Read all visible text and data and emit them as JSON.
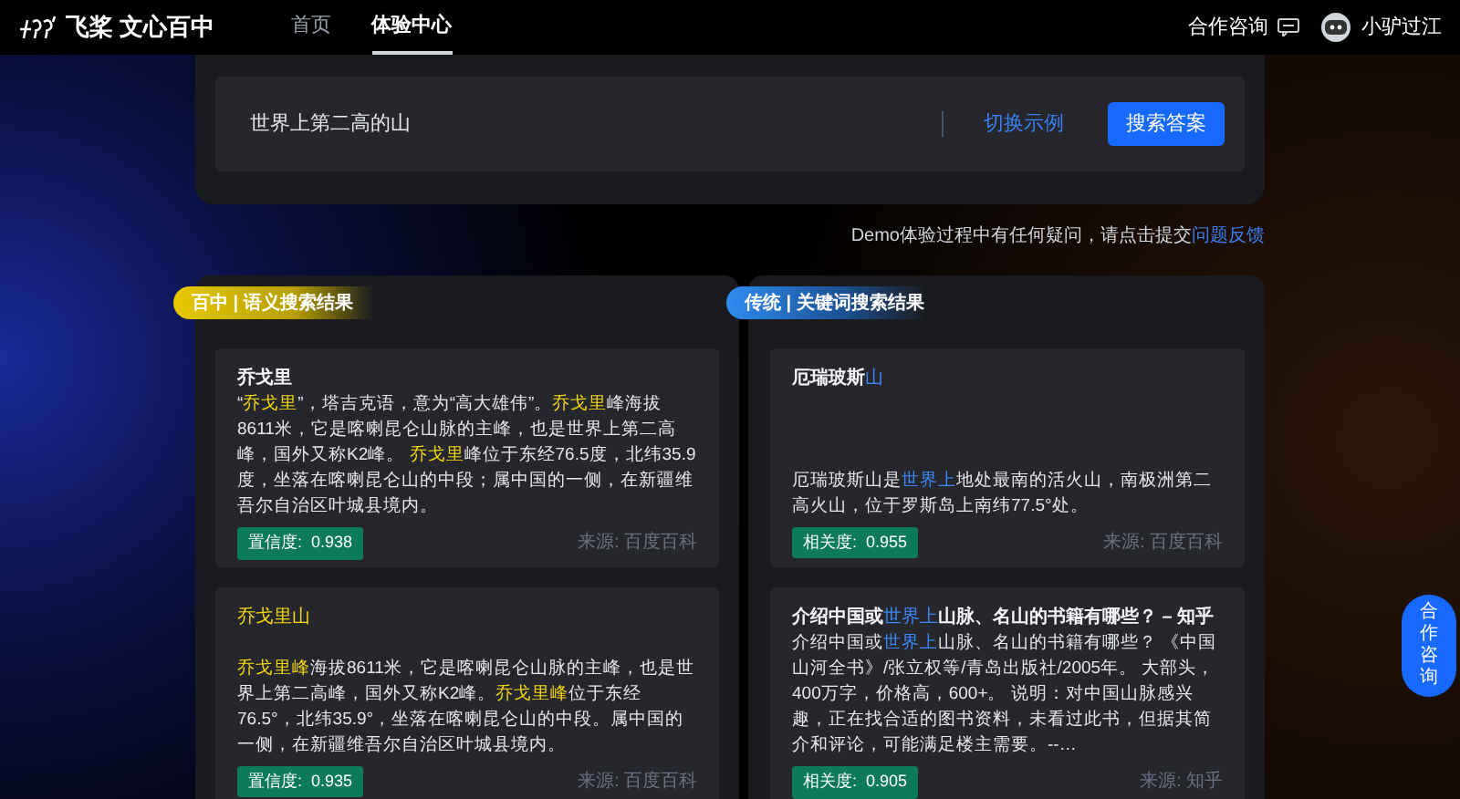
{
  "nav": {
    "logo": "飞桨 文心百中",
    "links": [
      {
        "label": "首页",
        "selected": false
      },
      {
        "label": "体验中心",
        "selected": true
      }
    ],
    "consult": "合作咨询",
    "user": "小驴过江"
  },
  "search": {
    "value": "世界上第二高的山",
    "switch_link": "切换示例",
    "button": "搜索答案"
  },
  "feedback": {
    "text": "Demo体验过程中有任何疑问，请点击提交",
    "link": "问题反馈"
  },
  "columns": [
    {
      "kind": "semantic",
      "badge": "百中 | 语义搜索结果",
      "results": [
        {
          "title": "乔戈里",
          "body": "“**乔戈里**”，塔吉克语，意为“高大雄伟”。**乔戈里**峰海拔8611米，它是喀喇昆仑山脉的主峰，也是世界上第二高峰，国外又称K2峰。 **乔戈里**峰位于东经76.5度，北纬35.9度，坐落在喀喇昆仑山的中段；属中国的一侧，在新疆维吾尔自治区叶城县境内。",
          "score": "置信度:  0.938",
          "source": "来源: 百度百科"
        },
        {
          "title": "**乔戈里山**",
          "body": "**乔戈里峰**海拔8611米，它是喀喇昆仑山脉的主峰，也是世界上第二高峰，国外又称K2峰。**乔戈里峰**位于东经76.5°，北纬35.9°，坐落在喀喇昆仑山的中段。属中国的一侧，在新疆维吾尔自治区叶城县境内。",
          "score": "置信度:  0.935",
          "source": "来源: 百度百科"
        }
      ]
    },
    {
      "kind": "keyword",
      "badge": "传统 | 关键词搜索结果",
      "results": [
        {
          "title": "厄瑞玻斯**山**",
          "body": "厄瑞玻斯山是**世界上**地处最南的活火山，南极洲第二高火山，位于罗斯岛上南纬77.5°处。",
          "score": "相关度:  0.955",
          "source": "来源: 百度百科"
        },
        {
          "title": "介绍中国或**世界上**山脉、名山的书籍有哪些？ – 知乎",
          "body": "介绍中国或**世界上**山脉、名山的书籍有哪些？ 《中国山河全书》/张立权等/青岛出版社/2005年。 大部头，400万字，价格高，600+。 说明：对中国山脉感兴趣，正在找合适的图书资料，未看过此书，但据其简介和评论，可能满足楼主需要。--…",
          "score": "相关度:  0.905",
          "source": "来源: 知乎"
        }
      ]
    }
  ],
  "float_button": "合作咨询"
}
